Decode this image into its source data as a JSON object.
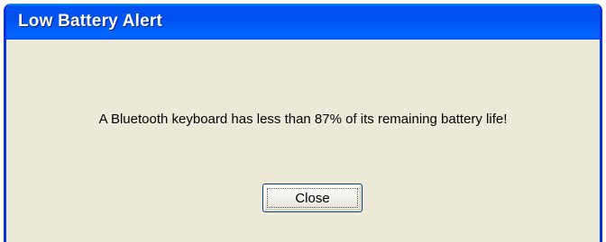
{
  "dialog": {
    "title": "Low Battery Alert",
    "message": "A Bluetooth keyboard has less than 87% of its remaining battery life!",
    "close_label": "Close"
  },
  "colors": {
    "titlebar": "#0054e3",
    "window_body": "#ece9d8",
    "border": "#0831d9"
  }
}
